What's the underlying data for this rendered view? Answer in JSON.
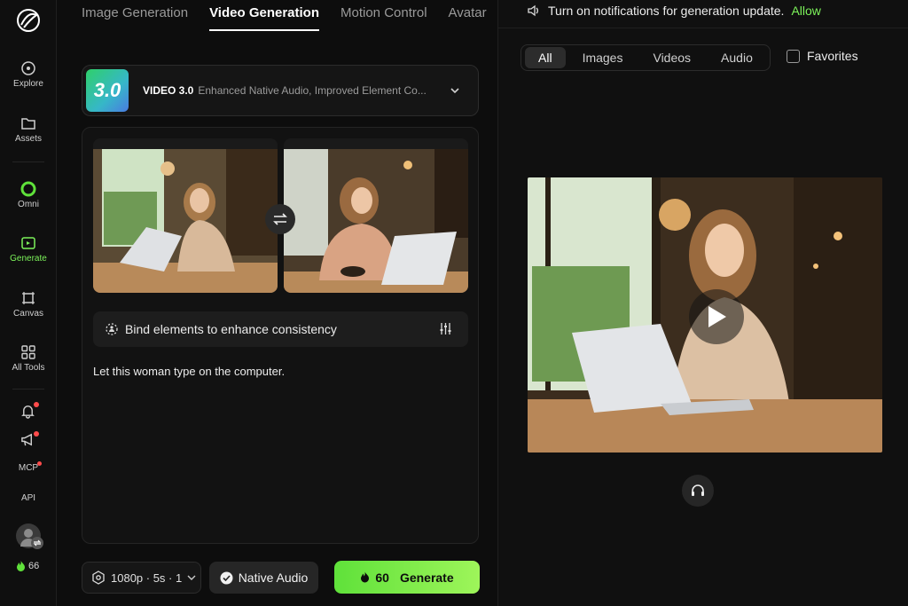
{
  "sidebar": {
    "items": [
      {
        "label": "Explore",
        "icon": "explore-icon"
      },
      {
        "label": "Assets",
        "icon": "folder-icon"
      },
      {
        "label": "Omni",
        "icon": "omni-icon"
      },
      {
        "label": "Generate",
        "icon": "generate-icon"
      },
      {
        "label": "Canvas",
        "icon": "canvas-icon"
      },
      {
        "label": "All Tools",
        "icon": "grid-icon"
      }
    ],
    "mcp_label": "MCP",
    "api_label": "API",
    "credits": "66"
  },
  "tabs": [
    "Image Generation",
    "Video Generation",
    "Motion Control",
    "Avatar"
  ],
  "model": {
    "badge": "3.0",
    "name": "VIDEO 3.0",
    "description": "Enhanced Native Audio, Improved Element Co..."
  },
  "editor": {
    "bind_label": "Bind elements to enhance consistency",
    "prompt": "Let this woman type on the computer."
  },
  "controls": {
    "settings": "1080p · 5s · 1",
    "native_audio": "Native Audio",
    "generate_cost": "60",
    "generate_label": "Generate"
  },
  "notification": {
    "text": "Turn on notifications for generation update.",
    "allow": "Allow"
  },
  "filters": [
    "All",
    "Images",
    "Videos",
    "Audio"
  ],
  "favorites_label": "Favorites",
  "colors": {
    "accent": "#7cf25a",
    "badge_red": "#ff4b4b"
  }
}
